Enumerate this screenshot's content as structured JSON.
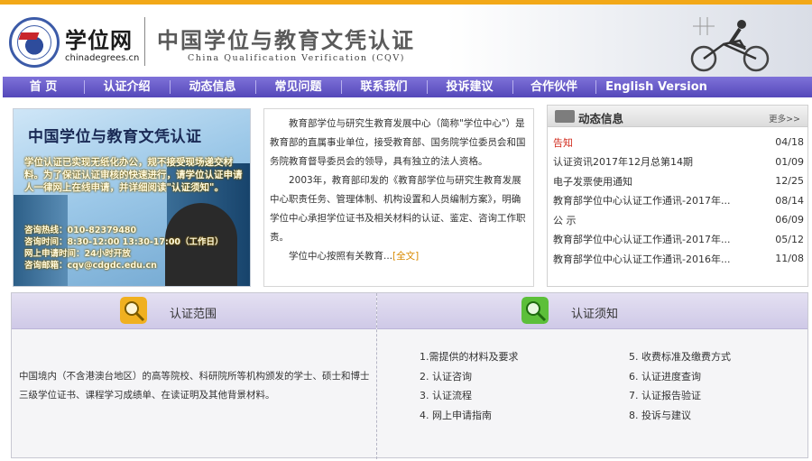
{
  "header": {
    "site_name": "学位网",
    "site_domain": "chinadegrees.cn",
    "brand_cn": "中国学位与教育文凭认证",
    "brand_en": "China Qualification Verification (CQV)"
  },
  "colors": {
    "top_stripe": "#f2a818",
    "nav_bg": "#5f53c4",
    "hot_news": "#d22c1e",
    "link": "#d98a00"
  },
  "nav": {
    "items": [
      {
        "label": "首  页"
      },
      {
        "label": "认证介绍"
      },
      {
        "label": "动态信息"
      },
      {
        "label": "常见问题"
      },
      {
        "label": "联系我们"
      },
      {
        "label": "投诉建议"
      },
      {
        "label": "合作伙伴"
      },
      {
        "label": "English Version"
      }
    ]
  },
  "banner": {
    "title": "中国学位与教育文凭认证",
    "text": "学位认证已实现无纸化办公，规不接受现场递交材料。为了保证认证审核的快速进行，请学位认证申请人一律网上在线申请，并详细阅读\"认证须知\"。",
    "hotline": "咨询热线：010-82379480",
    "hours": "咨询时间：8:30-12:00  13:30-17:00（工作日）",
    "online": "网上申请时间：24小时开放",
    "email": "咨询邮箱：cqv@cdgdc.edu.cn"
  },
  "intro": {
    "para1": "教育部学位与研究生教育发展中心（简称\"学位中心\"）是教育部的直属事业单位，接受教育部、国务院学位委员会和国务院教育督导委员会的领导，具有独立的法人资格。",
    "para2": "2003年，教育部印发的《教育部学位与研究生教育发展中心职责任务、管理体制、机构设置和人员编制方案》，明确学位中心承担学位证书及相关材料的认证、鉴定、咨询工作职责。",
    "para3": "学位中心按照有关教育...",
    "more_link": "[全文]"
  },
  "news": {
    "title": "动态信息",
    "more": "更多>>",
    "items": [
      {
        "title": "告知",
        "date": "04/18",
        "hot": true
      },
      {
        "title": "认证资讯2017年12月总第14期",
        "date": "01/09",
        "hot": false
      },
      {
        "title": "电子发票使用通知",
        "date": "12/25",
        "hot": false
      },
      {
        "title": "教育部学位中心认证工作通讯-2017年...",
        "date": "08/14",
        "hot": false
      },
      {
        "title": "公  示",
        "date": "06/09",
        "hot": false
      },
      {
        "title": "教育部学位中心认证工作通讯-2017年...",
        "date": "05/12",
        "hot": false
      },
      {
        "title": "教育部学位中心认证工作通讯-2016年...",
        "date": "11/08",
        "hot": false
      }
    ]
  },
  "scope": {
    "title": "认证范围",
    "text": "中国境内（不含港澳台地区）的高等院校、科研院所等机构颁发的学士、硕士和博士三级学位证书、课程学习成绩单、在读证明及其他背景材料。"
  },
  "notice": {
    "title": "认证须知",
    "col1": [
      "1.需提供的材料及要求",
      "2. 认证咨询",
      "3. 认证流程",
      "4. 网上申请指南"
    ],
    "col2": [
      "5. 收费标准及缴费方式",
      "6. 认证进度查询",
      "7. 认证报告验证",
      "8. 投诉与建议"
    ]
  }
}
